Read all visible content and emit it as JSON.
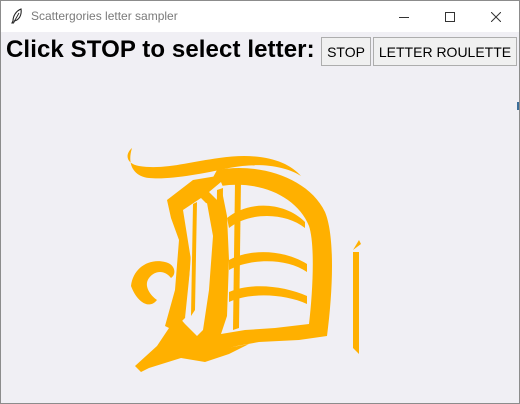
{
  "window": {
    "title": "Scattergories letter sampler",
    "app_icon": "feather-icon",
    "controls": [
      "minimize-icon",
      "maximize-icon",
      "close-icon"
    ]
  },
  "main": {
    "prompt": "Click STOP to select letter:",
    "stop_button": "STOP",
    "roulette_button": "LETTER ROULETTE",
    "displayed_letter": "D",
    "letter_style": "blackletter",
    "letter_color": "#ffb000"
  },
  "colors": {
    "background": "#f0eff4",
    "titlebar": "#ffffff",
    "button_face": "#f0f0f0"
  }
}
